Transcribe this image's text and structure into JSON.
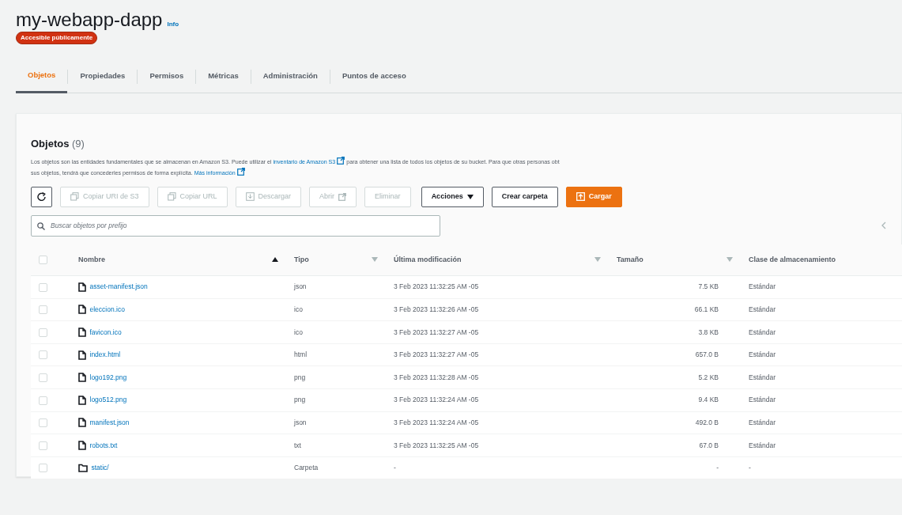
{
  "bucket": {
    "title": "my-webapp-dapp",
    "info_link": "Info",
    "access_badge": "Accesible públicamente"
  },
  "tabs": [
    {
      "label": "Objetos",
      "selected": true
    },
    {
      "label": "Propiedades",
      "selected": false
    },
    {
      "label": "Permisos",
      "selected": false
    },
    {
      "label": "Métricas",
      "selected": false
    },
    {
      "label": "Administración",
      "selected": false
    },
    {
      "label": "Puntos de acceso",
      "selected": false
    }
  ],
  "objects_panel": {
    "title": "Objetos",
    "count": "(9)",
    "description_lines": [
      [
        {
          "kind": "text",
          "text": "Los objetos son las entidades fundamentales que se almacenan en Amazon S3. Puede utilizar el "
        },
        {
          "kind": "link",
          "text": "inventario de Amazon S3"
        },
        {
          "kind": "text",
          "text": " para obtener una lista de todos los objetos de su bucket. Para que otras personas obt"
        }
      ],
      [
        {
          "kind": "text",
          "text": "sus objetos, tendrá que concederles permisos de forma explícita. "
        },
        {
          "kind": "link",
          "text": "Más información"
        }
      ]
    ],
    "toolbar": [
      {
        "kind": "refresh",
        "disabled": false
      },
      {
        "kind": "copy",
        "label": "Copiar URI de S3",
        "disabled": true
      },
      {
        "kind": "copy",
        "label": "Copiar URL",
        "disabled": true
      },
      {
        "kind": "download",
        "label": "Descargar",
        "disabled": true
      },
      {
        "kind": "open",
        "label": "Abrir",
        "disabled": true
      },
      {
        "kind": "plain",
        "label": "Eliminar",
        "disabled": true
      },
      {
        "kind": "dropdown",
        "label": "Acciones",
        "disabled": false
      },
      {
        "kind": "plain",
        "label": "Crear carpeta",
        "disabled": false
      },
      {
        "kind": "upload",
        "label": "Cargar",
        "disabled": false
      }
    ],
    "search": {
      "placeholder": "Buscar objetos por prefijo"
    },
    "table": {
      "select_all_checked": false,
      "columns": [
        {
          "label": "Nombre",
          "sorted": true
        },
        {
          "label": "Tipo",
          "sorted": false
        },
        {
          "label": "Última modificación",
          "sorted": false
        },
        {
          "label": "Tamaño",
          "sorted": false
        },
        {
          "label": "Clase de almacenamiento"
        }
      ],
      "rows": [
        {
          "kind": "file",
          "checked": false,
          "name": "asset-manifest.json",
          "type": "json",
          "modified": "3 Feb 2023 11:32:25 AM -05",
          "size": "7.5 KB",
          "storage_class": "Estándar"
        },
        {
          "kind": "file",
          "checked": false,
          "name": "eleccion.ico",
          "type": "ico",
          "modified": "3 Feb 2023 11:32:26 AM -05",
          "size": "66.1 KB",
          "storage_class": "Estándar"
        },
        {
          "kind": "file",
          "checked": false,
          "name": "favicon.ico",
          "type": "ico",
          "modified": "3 Feb 2023 11:32:27 AM -05",
          "size": "3.8 KB",
          "storage_class": "Estándar"
        },
        {
          "kind": "file",
          "checked": false,
          "name": "index.html",
          "type": "html",
          "modified": "3 Feb 2023 11:32:27 AM -05",
          "size": "657.0 B",
          "storage_class": "Estándar"
        },
        {
          "kind": "file",
          "checked": false,
          "name": "logo192.png",
          "type": "png",
          "modified": "3 Feb 2023 11:32:28 AM -05",
          "size": "5.2 KB",
          "storage_class": "Estándar"
        },
        {
          "kind": "file",
          "checked": false,
          "name": "logo512.png",
          "type": "png",
          "modified": "3 Feb 2023 11:32:24 AM -05",
          "size": "9.4 KB",
          "storage_class": "Estándar"
        },
        {
          "kind": "file",
          "checked": false,
          "name": "manifest.json",
          "type": "json",
          "modified": "3 Feb 2023 11:32:24 AM -05",
          "size": "492.0 B",
          "storage_class": "Estándar"
        },
        {
          "kind": "file",
          "checked": false,
          "name": "robots.txt",
          "type": "txt",
          "modified": "3 Feb 2023 11:32:25 AM -05",
          "size": "67.0 B",
          "storage_class": "Estándar"
        },
        {
          "kind": "folder",
          "checked": false,
          "name": "static/",
          "type": "Carpeta",
          "modified": "-",
          "size": "-",
          "storage_class": "-"
        }
      ]
    }
  }
}
